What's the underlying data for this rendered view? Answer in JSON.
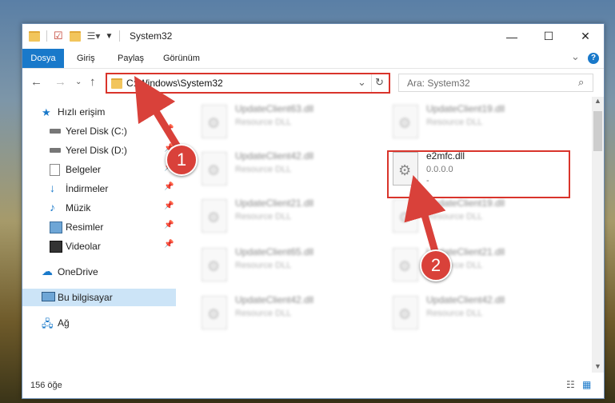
{
  "window": {
    "title": "System32",
    "minimize": "—",
    "maximize": "☐",
    "close": "✕"
  },
  "ribbon": {
    "tabs": [
      "Dosya",
      "Giriş",
      "Paylaş",
      "Görünüm"
    ],
    "collapse": "⌄",
    "help": "?"
  },
  "address": {
    "path": "C:\\Windows\\System32",
    "search_placeholder": "Ara: System32"
  },
  "sidebar": {
    "items": [
      {
        "label": "Hızlı erişim",
        "icon": "star-icon"
      },
      {
        "label": "Yerel Disk (C:)",
        "icon": "drive-icon"
      },
      {
        "label": "Yerel Disk (D:)",
        "icon": "drive-icon"
      },
      {
        "label": "Belgeler",
        "icon": "documents-icon"
      },
      {
        "label": "İndirmeler",
        "icon": "download-icon"
      },
      {
        "label": "Müzik",
        "icon": "music-icon"
      },
      {
        "label": "Resimler",
        "icon": "pictures-icon"
      },
      {
        "label": "Videolar",
        "icon": "video-icon"
      },
      {
        "label": "OneDrive",
        "icon": "cloud-icon"
      },
      {
        "label": "Bu bilgisayar",
        "icon": "computer-icon"
      },
      {
        "label": "Ağ",
        "icon": "network-icon"
      }
    ]
  },
  "files": [
    {
      "name": "UpdateClient63.dll",
      "desc": "Resource DLL"
    },
    {
      "name": "UpdateClient19.dll",
      "desc": "Resource DLL"
    },
    {
      "name": "UpdateClient42.dll",
      "desc": "Resource DLL"
    },
    {
      "name": "e2mfc.dll",
      "desc": "0.0.0.0",
      "extra": "-"
    },
    {
      "name": "UpdateClient21.dll",
      "desc": "Resource DLL"
    },
    {
      "name": "UpdateClient19.dll",
      "desc": "Resource DLL"
    },
    {
      "name": "UpdateClient65.dll",
      "desc": "Resource DLL"
    },
    {
      "name": "UpdateClient21.dll",
      "desc": "Resource DLL"
    },
    {
      "name": "UpdateClient42.dll",
      "desc": "Resource DLL"
    },
    {
      "name": "UpdateClient42.dll",
      "desc": "Resource DLL"
    }
  ],
  "status": {
    "count": "156 öğe"
  },
  "markers": [
    "1",
    "2"
  ],
  "colors": {
    "accent": "#1979ca",
    "highlight": "#d9342b",
    "selected": "#cce4f7"
  }
}
